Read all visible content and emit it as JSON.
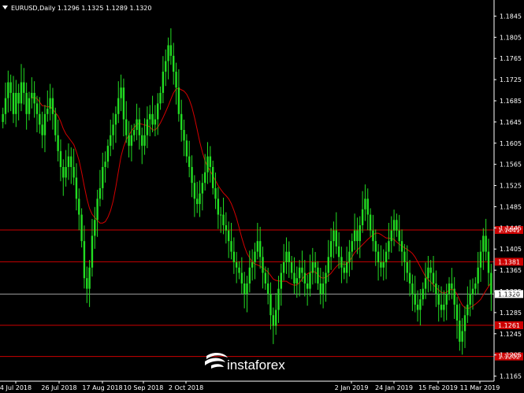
{
  "header": {
    "symbol_line": "EURUSD,Daily  1.1296 1.1325 1.1289 1.1320",
    "menu_icon": "triangle-down-icon"
  },
  "watermark": {
    "text": "instaforex",
    "icon": "instaforex-swoosh-logo"
  },
  "colors": {
    "background": "#000000",
    "candle": "#22dd22",
    "ma": "#d40000",
    "level_line": "#cc0000",
    "grid_axis": "#ffffff"
  },
  "chart_data": {
    "type": "candlestick",
    "title": "EURUSD,Daily",
    "ohlc_last": {
      "open": "1.1296",
      "high": "1.1325",
      "low": "1.1289",
      "close": "1.1320"
    },
    "y_ticks": [
      "1.1845",
      "1.1805",
      "1.1765",
      "1.1725",
      "1.1685",
      "1.1645",
      "1.1605",
      "1.1565",
      "1.1525",
      "1.1485",
      "1.1445",
      "1.1405",
      "1.1365",
      "1.1325",
      "1.1285",
      "1.1245",
      "1.1205",
      "1.1165"
    ],
    "x_ticks": [
      "4 Jul 2018",
      "26 Jul 2018",
      "17 Aug 2018",
      "10 Sep 2018",
      "2 Oct 2018",
      "2 Jan 2019",
      "24 Jan 2019",
      "15 Feb 2019",
      "11 Mar 2019"
    ],
    "ylim": [
      1.1165,
      1.1845
    ],
    "level_lines": [
      {
        "value": 1.1441,
        "label": "1.1441"
      },
      {
        "value": 1.1381,
        "label": "1.1381"
      },
      {
        "value": 1.1261,
        "label": "1.1261"
      },
      {
        "value": 1.1202,
        "label": "1.1202"
      }
    ],
    "current_price": {
      "value": 1.132,
      "label": "1.1320"
    },
    "close_series": [
      1.166,
      1.169,
      1.172,
      1.17,
      1.166,
      1.17,
      1.168,
      1.172,
      1.17,
      1.166,
      1.169,
      1.17,
      1.168,
      1.166,
      1.164,
      1.162,
      1.166,
      1.167,
      1.169,
      1.166,
      1.162,
      1.159,
      1.156,
      1.154,
      1.156,
      1.158,
      1.156,
      1.154,
      1.15,
      1.147,
      1.142,
      1.135,
      1.133,
      1.137,
      1.143,
      1.146,
      1.15,
      1.152,
      1.156,
      1.157,
      1.16,
      1.162,
      1.164,
      1.166,
      1.169,
      1.171,
      1.165,
      1.162,
      1.16,
      1.162,
      1.163,
      1.165,
      1.162,
      1.16,
      1.162,
      1.165,
      1.166,
      1.164,
      1.165,
      1.168,
      1.17,
      1.174,
      1.176,
      1.179,
      1.177,
      1.174,
      1.171,
      1.166,
      1.163,
      1.161,
      1.158,
      1.156,
      1.153,
      1.15,
      1.149,
      1.151,
      1.153,
      1.155,
      1.158,
      1.156,
      1.152,
      1.15,
      1.147,
      1.147,
      1.145,
      1.144,
      1.142,
      1.14,
      1.138,
      1.137,
      1.136,
      1.134,
      1.132,
      1.134,
      1.137,
      1.138,
      1.14,
      1.142,
      1.139,
      1.136,
      1.134,
      1.132,
      1.128,
      1.126,
      1.129,
      1.133,
      1.136,
      1.138,
      1.14,
      1.138,
      1.136,
      1.134,
      1.135,
      1.137,
      1.136,
      1.134,
      1.133,
      1.136,
      1.138,
      1.137,
      1.134,
      1.132,
      1.134,
      1.136,
      1.139,
      1.142,
      1.144,
      1.141,
      1.139,
      1.137,
      1.136,
      1.138,
      1.14,
      1.142,
      1.144,
      1.142,
      1.145,
      1.148,
      1.15,
      1.147,
      1.144,
      1.142,
      1.14,
      1.138,
      1.137,
      1.138,
      1.14,
      1.142,
      1.144,
      1.146,
      1.144,
      1.142,
      1.14,
      1.138,
      1.136,
      1.134,
      1.132,
      1.13,
      1.129,
      1.131,
      1.133,
      1.135,
      1.137,
      1.136,
      1.134,
      1.132,
      1.13,
      1.129,
      1.13,
      1.132,
      1.134,
      1.133,
      1.13,
      1.127,
      1.123,
      1.125,
      1.128,
      1.13,
      1.132,
      1.133,
      1.134,
      1.137,
      1.14,
      1.143,
      1.14,
      1.136,
      1.132
    ]
  }
}
